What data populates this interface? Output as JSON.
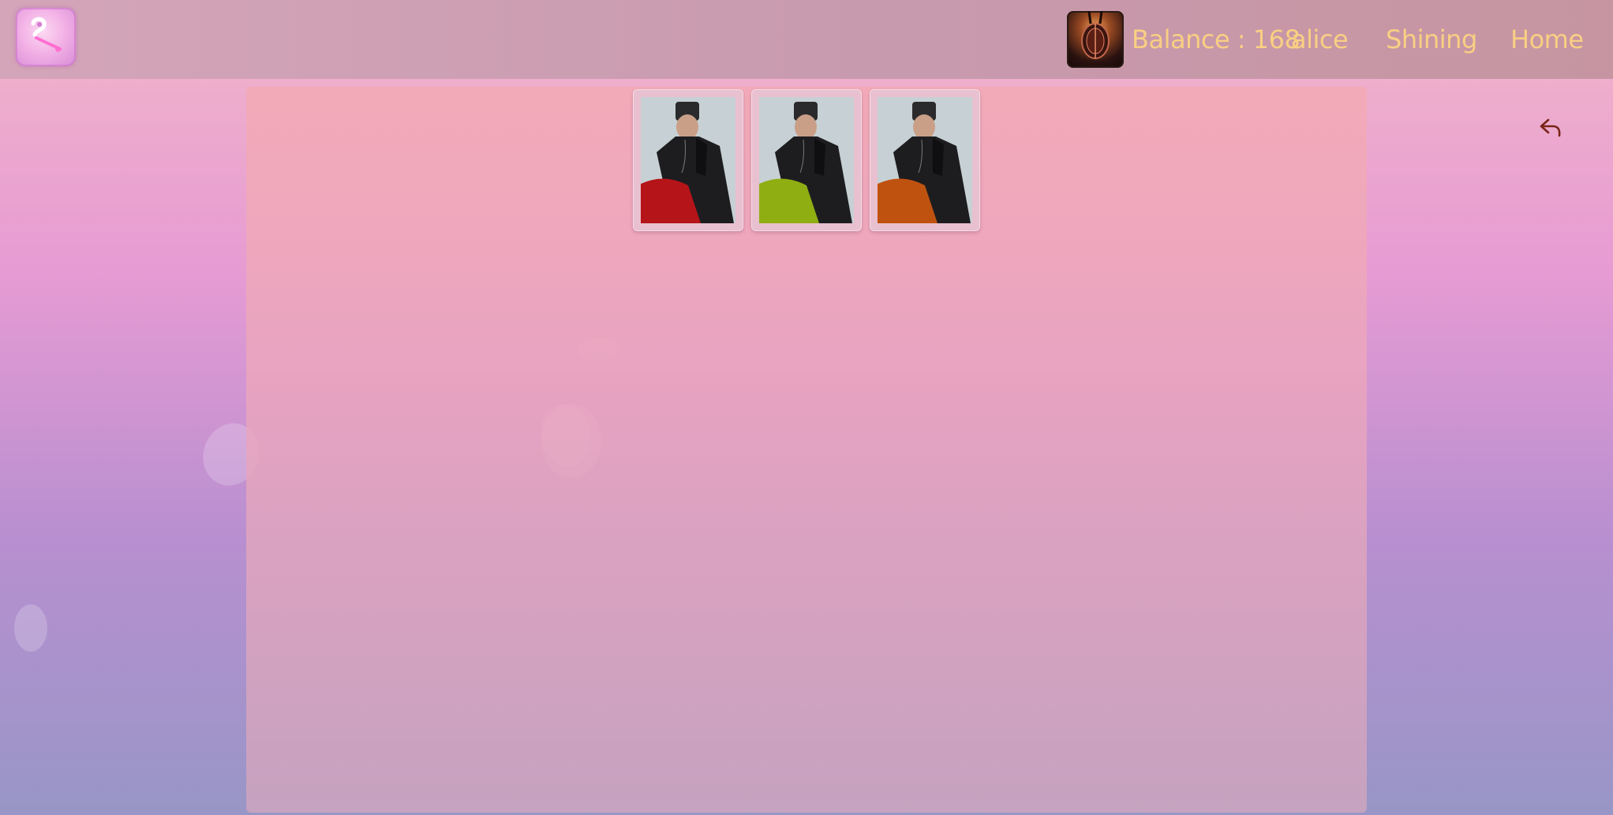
{
  "header": {
    "balance_text": "Balance : 168",
    "username": "alice",
    "nav_shining": "Shining",
    "nav_home": "Home",
    "text_color": "#f9cf83"
  },
  "cards": [
    {
      "cloth_color": "#b51418"
    },
    {
      "cloth_color": "#8fae12"
    },
    {
      "cloth_color": "#c0520f"
    }
  ],
  "icons": {
    "logo": "brand-logo-icon",
    "avatar": "user-avatar",
    "back": "reply-arrow-icon"
  }
}
